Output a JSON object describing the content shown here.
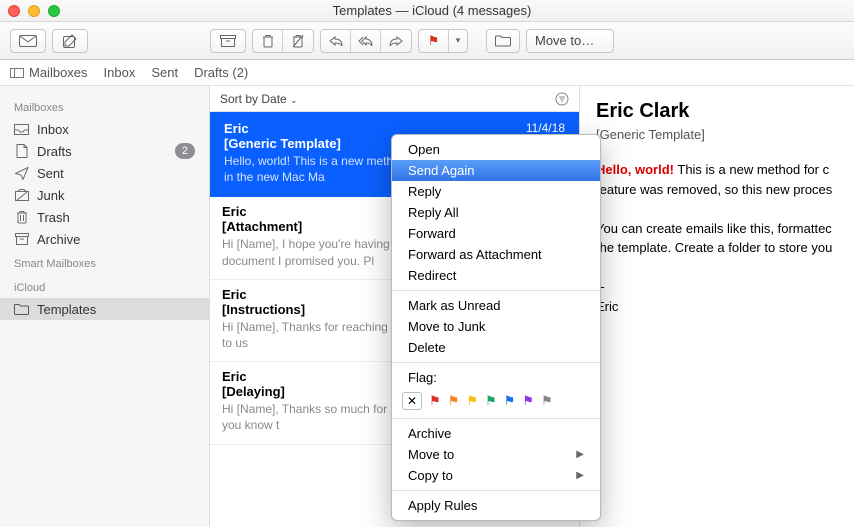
{
  "window": {
    "title": "Templates — iCloud (4 messages)"
  },
  "toolbar": {
    "moveto_label": "Move to…"
  },
  "favbar": {
    "mailboxes": "Mailboxes",
    "inbox": "Inbox",
    "sent": "Sent",
    "drafts": "Drafts (2)"
  },
  "sidebar": {
    "headers": {
      "mailboxes": "Mailboxes",
      "smart": "Smart Mailboxes",
      "icloud": "iCloud"
    },
    "items": {
      "inbox": "Inbox",
      "drafts": "Drafts",
      "drafts_badge": "2",
      "sent": "Sent",
      "junk": "Junk",
      "trash": "Trash",
      "archive": "Archive",
      "templates": "Templates"
    }
  },
  "msglist": {
    "sort_label": "Sort by Date",
    "messages": [
      {
        "from": "Eric",
        "subject": "[Generic Template]",
        "date": "11/4/18",
        "preview": "Hello, world! This is a new method for creating email templates in the new Mac Ma"
      },
      {
        "from": "Eric",
        "subject": "[Attachment]",
        "date": "",
        "preview": "Hi [Name], I hope you're having a great day. Here's the document I promised you. Pl"
      },
      {
        "from": "Eric",
        "subject": "[Instructions]",
        "date": "",
        "preview": "Hi [Name], Thanks for reaching out about [procedure]! We prefer to us"
      },
      {
        "from": "Eric",
        "subject": "[Delaying]",
        "date": "",
        "preview": "Hi [Name], Thanks so much for reaching out. I just wanted to let you know t"
      }
    ]
  },
  "reader": {
    "from": "Eric Clark",
    "subject": "[Generic Template]",
    "hello": "Hello, world!",
    "body_line1": " This is a new method for c",
    "body_line2": "feature was removed, so this new proces",
    "body_line3": "You can create emails like this, formattec",
    "body_line4": "the template. Create a folder to store you",
    "sig_dashes": "--",
    "sig_name": "Eric"
  },
  "contextmenu": {
    "open": "Open",
    "send_again": "Send Again",
    "reply": "Reply",
    "reply_all": "Reply All",
    "forward": "Forward",
    "forward_attachment": "Forward as Attachment",
    "redirect": "Redirect",
    "mark_unread": "Mark as Unread",
    "move_junk": "Move to Junk",
    "delete": "Delete",
    "flag_label": "Flag:",
    "archive": "Archive",
    "move_to": "Move to",
    "copy_to": "Copy to",
    "apply_rules": "Apply Rules",
    "flag_colors": [
      "#d93025",
      "#f5851f",
      "#f4c20d",
      "#1ea362",
      "#1a73e8",
      "#9334e6",
      "#878787"
    ]
  }
}
